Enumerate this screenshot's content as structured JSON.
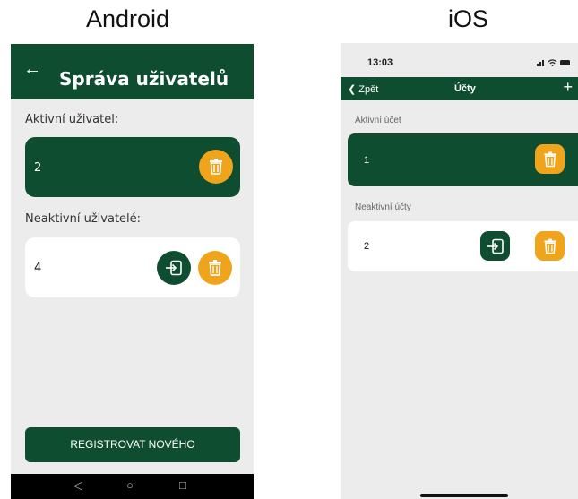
{
  "captions": {
    "android": "Android",
    "ios": "iOS"
  },
  "android": {
    "back_icon": "arrow-left-icon",
    "title": "Správa uživatelů",
    "active_label": "Aktivní uživatel:",
    "active_user": "2",
    "inactive_label": "Neaktivní uživatelé:",
    "inactive_users": [
      "4"
    ],
    "register_button": "REGISTROVAT NOVÉHO",
    "nav_icons": [
      "nav-back-icon",
      "nav-home-icon",
      "nav-recents-icon"
    ]
  },
  "ios": {
    "status": {
      "time": "13:03"
    },
    "nav": {
      "back": "Zpět",
      "title": "Účty",
      "plus_icon": "plus-icon"
    },
    "active_label": "Aktivní účet",
    "active_account": "1",
    "inactive_label": "Neaktivní účty",
    "inactive_accounts": [
      "2"
    ]
  },
  "colors": {
    "brand_green": "#0f4d31",
    "accent_orange": "#f0a41c",
    "background": "#ececec"
  },
  "icons": [
    "trash-icon",
    "login-icon"
  ]
}
